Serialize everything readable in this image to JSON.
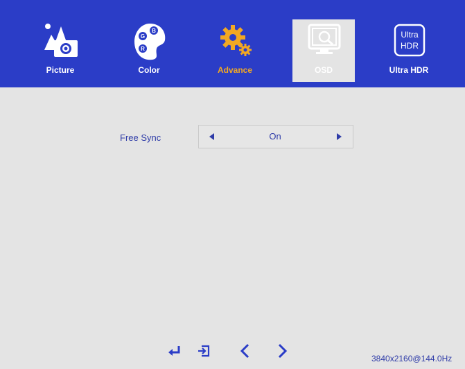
{
  "tabs": [
    {
      "label": "Picture",
      "icon": "picture-icon",
      "active": false
    },
    {
      "label": "Color",
      "icon": "palette-icon",
      "active": false
    },
    {
      "label": "Advance",
      "icon": "gear-icon",
      "active": true
    },
    {
      "label": "OSD",
      "icon": "monitor-search-icon",
      "active": false
    },
    {
      "label": "Ultra HDR",
      "icon": "ultra-hdr-icon",
      "icon_text_line1": "Ultra",
      "icon_text_line2": "HDR",
      "active": false
    }
  ],
  "palette_letters": [
    "B",
    "G",
    "R"
  ],
  "setting": {
    "label": "Free Sync",
    "value": "On"
  },
  "nav_keys": [
    "enter-icon",
    "exit-icon",
    "chevron-left-icon",
    "chevron-right-icon"
  ],
  "status": {
    "resolution": "3840x2160@144.0Hz"
  },
  "colors": {
    "header": "#2b3dc7",
    "active": "#f2a822",
    "text": "#2f3ca8",
    "background": "#e4e4e4"
  }
}
